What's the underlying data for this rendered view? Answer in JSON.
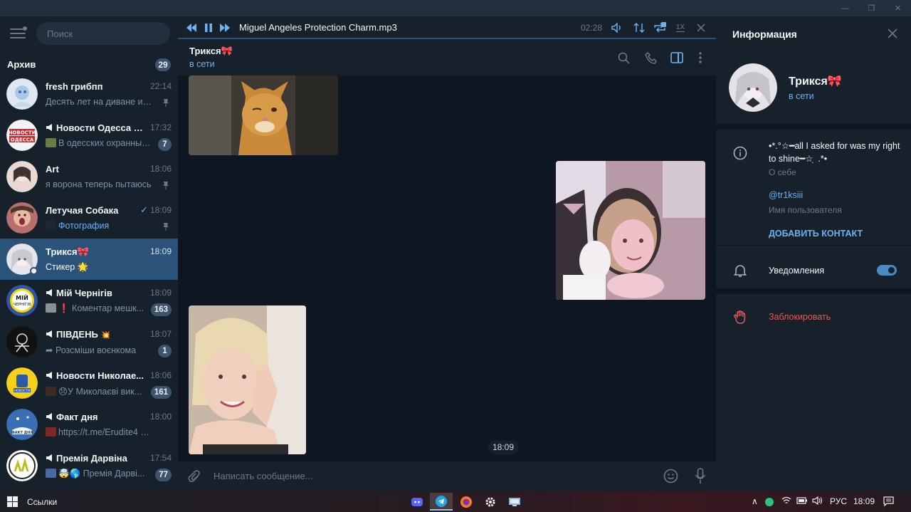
{
  "window": {
    "minimize": "—",
    "maximize": "❐",
    "close": "✕"
  },
  "sidebar": {
    "search_placeholder": "Поиск",
    "archive": {
      "label": "Архив",
      "count": "29"
    },
    "chats": [
      {
        "name": "fresh грибпп",
        "time": "22:14",
        "preview": "Десять лет на диване и х...",
        "pinned": true
      },
      {
        "name": "Новости Одесса | ...",
        "time": "17:32",
        "preview": "В одесских охранных ...",
        "badge": "7",
        "channel": true
      },
      {
        "name": "Art",
        "time": "18:06",
        "preview": "я ворона теперь пытаюсь",
        "pinned": true
      },
      {
        "name": "Летучая Собака",
        "time": "18:09",
        "preview": "Фотография",
        "pinned": true,
        "read": true
      },
      {
        "name": "Трикся",
        "time": "18:09",
        "preview": "Стикер 🌟",
        "active": true
      },
      {
        "name": "Мій Чернігів",
        "time": "18:09",
        "preview": "❗ Коментар мешк...",
        "badge": "163",
        "channel": true
      },
      {
        "name": "ПІВДЕНЬ",
        "time": "18:07",
        "preview": "Розсміши воєнкома",
        "badge": "1",
        "channel": true
      },
      {
        "name": "Новости Николае...",
        "time": "18:06",
        "preview": "😞У Миколаєві вик...",
        "badge": "161",
        "channel": true
      },
      {
        "name": "Факт дня",
        "time": "18:00",
        "preview": "https://t.me/Erudite4 🔥...",
        "channel": true
      },
      {
        "name": "Премія Дарвіна",
        "time": "17:54",
        "preview": "🤯🌎 Премія Дарві...",
        "badge": "77",
        "channel": true
      }
    ]
  },
  "player": {
    "title": "Miguel Angeles Protection Charm.mp3",
    "time": "02:28",
    "speed": "1X",
    "repeat_badge": "1"
  },
  "chat": {
    "name": "Трикся🎀",
    "status": "в сети",
    "message_time": "18:09",
    "composer_placeholder": "Написать сообщение..."
  },
  "info": {
    "title": "Информация",
    "name": "Трикся🎀",
    "status": "в сети",
    "bio": "•*.°☆━all I asked for was my right to shine━☆ ̣ .*•",
    "bio_label": "О себе",
    "username": "@tr1ksiii",
    "username_label": "Имя пользователя",
    "add_contact": "ДОБАВИТЬ КОНТАКТ",
    "notifications": "Уведомления",
    "notifications_on": true,
    "block": "Заблокировать"
  },
  "taskbar": {
    "links": "Ссылки",
    "lang": "РУС",
    "time": "18:09"
  },
  "colors": {
    "accent": "#6ab3f3",
    "active": "#2b5278",
    "danger": "#e05a5a",
    "panel": "#17212b",
    "bg": "#0e1621"
  }
}
